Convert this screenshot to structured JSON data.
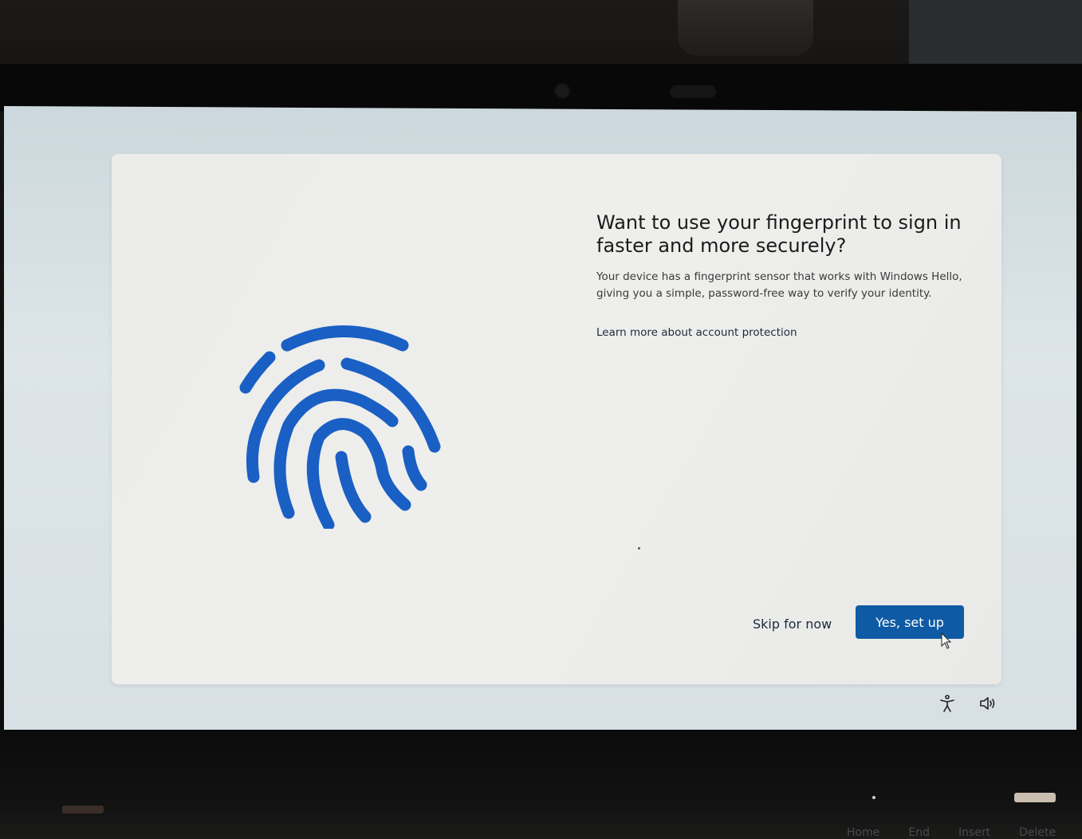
{
  "setup": {
    "title": "Want to use your fingerprint to sign in faster and more securely?",
    "description": "Your device has a fingerprint sensor that works with Windows Hello, giving you a simple, password-free way to verify your identity.",
    "learn_more_link": "Learn more about account protection",
    "skip_label": "Skip for now",
    "confirm_label": "Yes, set up",
    "illustration_icon": "fingerprint-icon"
  },
  "system_tray": {
    "accessibility_icon": "accessibility-icon",
    "volume_icon": "volume-icon"
  },
  "keyboard": {
    "keys": [
      "Home",
      "End",
      "Insert",
      "Delete"
    ]
  },
  "colors": {
    "accent": "#0f5aa4",
    "fingerprint": "#1a5fc4",
    "card_background": "#ececea",
    "screen_background": "#d9e2e6"
  }
}
